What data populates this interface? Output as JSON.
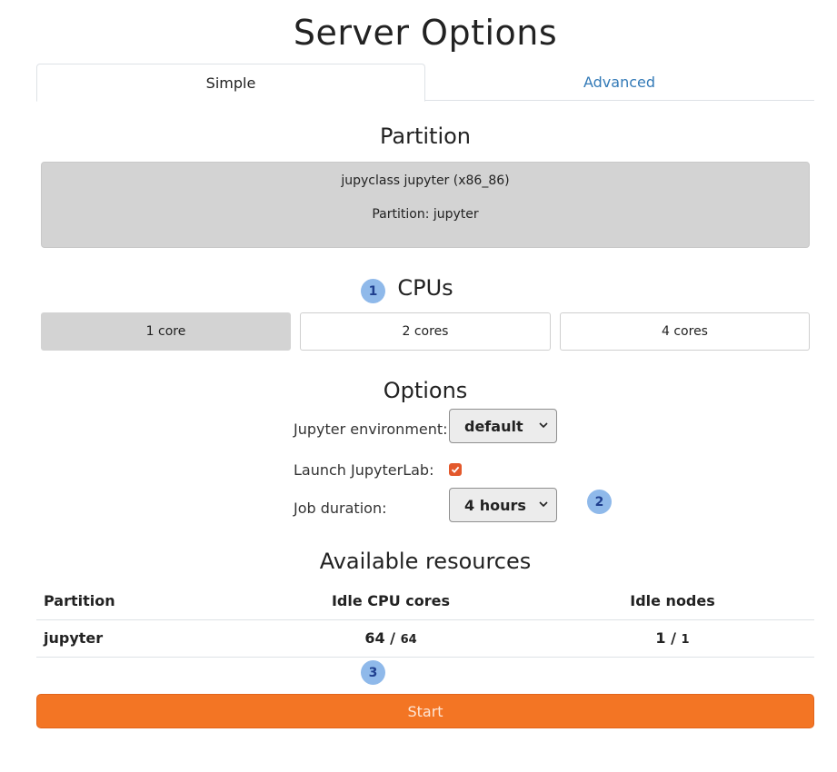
{
  "page_title": "Server Options",
  "tabs": [
    {
      "label": "Simple",
      "active": true
    },
    {
      "label": "Advanced",
      "active": false
    }
  ],
  "partition_section": {
    "heading": "Partition",
    "line1": "jupyclass jupyter (x86_86)",
    "line2": "Partition: jupyter"
  },
  "cpus_section": {
    "heading": "CPUs",
    "badge": "1",
    "options": [
      {
        "label": "1 core",
        "selected": true
      },
      {
        "label": "2 cores",
        "selected": false
      },
      {
        "label": "4 cores",
        "selected": false
      }
    ]
  },
  "options_section": {
    "heading": "Options",
    "env_label": "Jupyter environment:",
    "env_value": "default",
    "lab_label": "Launch JupyterLab:",
    "lab_checked": true,
    "duration_label": "Job duration:",
    "duration_value": "4 hours",
    "badge": "2"
  },
  "resources_section": {
    "heading": "Available resources",
    "columns": [
      "Partition",
      "Idle CPU cores",
      "Idle nodes"
    ],
    "rows": [
      {
        "partition": "jupyter",
        "idle_cpu": "64",
        "total_cpu": "64",
        "idle_nodes": "1",
        "total_nodes": "1"
      }
    ],
    "separator": "/",
    "badge": "3"
  },
  "start_button": {
    "label": "Start"
  },
  "colors": {
    "accent": "#f37524",
    "link": "#337ab7",
    "badge": "#8fb9ea",
    "checkbox": "#e3582b",
    "selected": "#d3d3d3"
  }
}
